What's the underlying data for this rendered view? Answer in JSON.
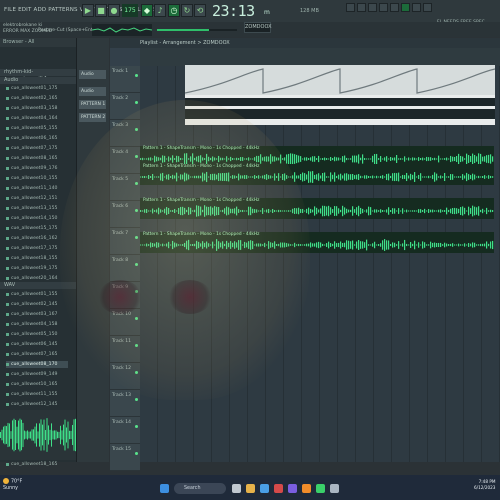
{
  "menubar": {
    "menu_text": "FILE EDIT ADD PATTERNS VIEW OPTIONS TOOLS HELP",
    "tempo": "175",
    "time": "23:13",
    "time_unit": "m",
    "pattern_select": "ZOMDOOX",
    "notice": "FL NEEDS FREE SPEC\nMixer Studio Bedrooms",
    "cpu": "128 MB"
  },
  "hint": {
    "line1": "elektrobrokane ki",
    "line2": "ERROR MAX ZOOMED",
    "line3": "Restore-Cut (Space+Enter)"
  },
  "sidebar": {
    "header": "Browser - All",
    "project_folder": "rhythm-kid-cam_anime_pill.1",
    "folder1": "Audio",
    "files1": [
      "cue_allsweet01_175",
      "cue_allsweet02_165",
      "cue_allsweet03_158",
      "cue_allsweet04_164",
      "cue_allsweet05_155",
      "cue_allsweet06_165",
      "cue_allsweet07_175",
      "cue_allsweet08_165",
      "cue_allsweet09_176",
      "cue_allsweet10_155",
      "cue_allsweet11_140",
      "cue_allsweet12_151",
      "cue_allsweet13_155",
      "cue_allsweet14_150",
      "cue_allsweet15_175",
      "cue_allsweet16_162",
      "cue_allsweet17_175",
      "cue_allsweet18_155",
      "cue_allsweet19_175",
      "cue_allsweet20_164"
    ],
    "folder2": "WAV",
    "files2": [
      "cue_allsweet01_155",
      "cue_allsweet02_145",
      "cue_allsweet03_167",
      "cue_allsweet04_158",
      "cue_allsweet05_150",
      "cue_allsweet06_145",
      "cue_allsweet07_165",
      "cue_allsweet08_170",
      "cue_allsweet09_149",
      "cue_allsweet10_165",
      "cue_allsweet11_155",
      "cue_allsweet12_145",
      "cue_allsweet13_155",
      "cue_allsweet14_145",
      "cue_allsweet15_150",
      "cue_allsweet16_162",
      "cue_allsweet17_137",
      "cue_allsweet18_165"
    ],
    "selected_index": 7
  },
  "patterns": [
    "Audio",
    "Audio",
    "PATTERN 1",
    "PATTERN 2"
  ],
  "playlist": {
    "title": "Playlist - Arrangement > ZOMDOOX",
    "tracks": [
      "Track 1",
      "Track 2",
      "Track 3",
      "Track 4",
      "Track 5",
      "Track 6",
      "Track 7",
      "Track 8",
      "Track 9",
      "Track 10",
      "Track 11",
      "Track 12",
      "Track 13",
      "Track 14",
      "Track 15"
    ],
    "clip_label": "Pattern 1 - ShapeTransm - Mono - 1s Chopped - 44kHz",
    "pattern_header": "cue_allsweet_165"
  },
  "taskbar": {
    "temp": "70°F",
    "weather": "Sunny",
    "search": "Search",
    "clock": "7:48 PM",
    "date": "6/12/2023"
  },
  "colors": {
    "accent": "#35d07a",
    "clip_bg": "#152b20",
    "wave": "#3fe089"
  }
}
